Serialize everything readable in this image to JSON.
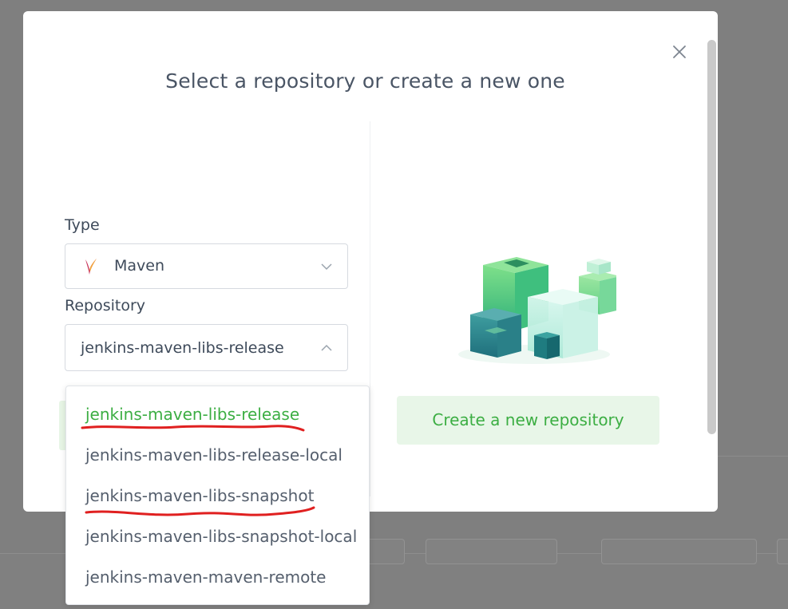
{
  "modal": {
    "title": "Select a repository or create a new one",
    "close_icon": "close-icon"
  },
  "form": {
    "type_label": "Type",
    "type_value": "Maven",
    "type_icon": "maven-icon",
    "repository_label": "Repository",
    "repository_value": "jenkins-maven-libs-release"
  },
  "repository_options": [
    {
      "label": "jenkins-maven-libs-release",
      "selected": true
    },
    {
      "label": "jenkins-maven-libs-release-local",
      "selected": false
    },
    {
      "label": "jenkins-maven-libs-snapshot",
      "selected": false
    },
    {
      "label": "jenkins-maven-libs-snapshot-local",
      "selected": false
    },
    {
      "label": "jenkins-maven-maven-remote",
      "selected": false
    }
  ],
  "create": {
    "button_label": "Create a new repository",
    "illustration": "cubes-illustration"
  },
  "colors": {
    "accent_green": "#3cae43",
    "button_bg": "#e8f6e8",
    "annotation_red": "#e02020"
  }
}
